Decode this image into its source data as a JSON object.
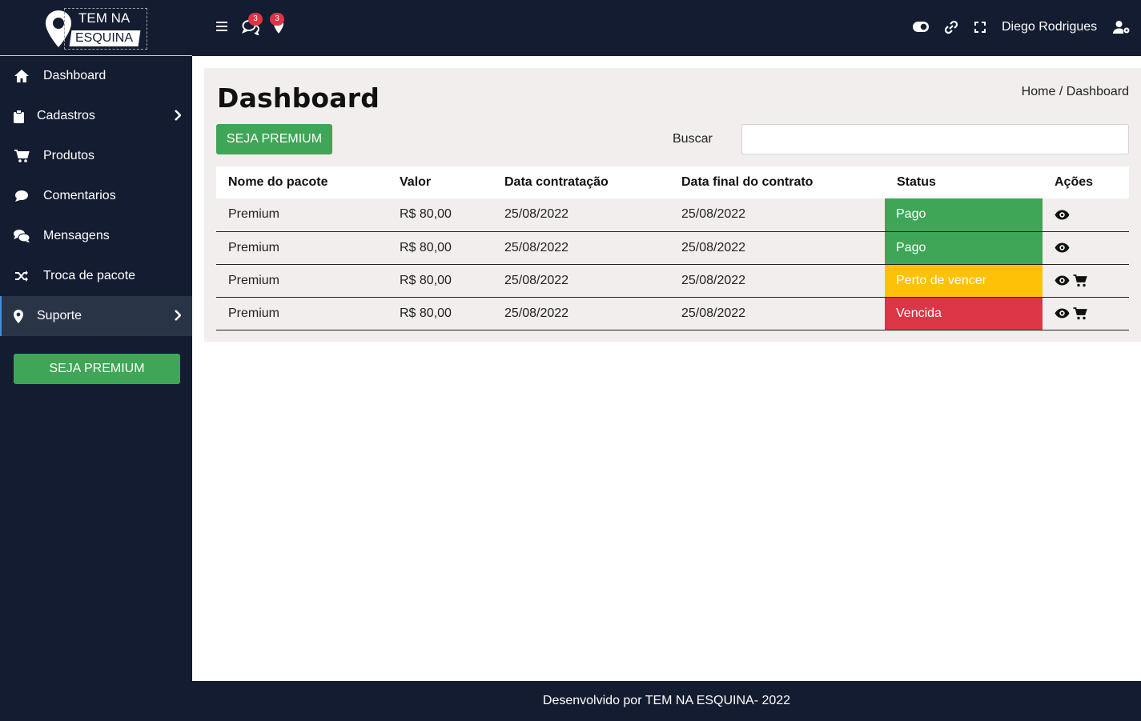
{
  "brand": {
    "line1": "TEM NA",
    "line2": "ESQUINA"
  },
  "sidebar": {
    "items": [
      {
        "label": "Dashboard",
        "icon": "home-icon"
      },
      {
        "label": "Cadastros",
        "icon": "clipboard-icon",
        "has_submenu": true
      },
      {
        "label": "Produtos",
        "icon": "cart-icon"
      },
      {
        "label": "Comentarios",
        "icon": "comment-icon"
      },
      {
        "label": "Mensagens",
        "icon": "comments-icon"
      },
      {
        "label": "Troca de pacote",
        "icon": "shuffle-icon"
      },
      {
        "label": "Suporte",
        "icon": "map-marker-icon",
        "has_submenu": true,
        "active": true
      }
    ],
    "premium_button": "SEJA PREMIUM"
  },
  "topbar": {
    "messages_badge": "3",
    "location_badge": "3",
    "user_name": "Diego Rodrigues",
    "icons": [
      "menu-icon",
      "comments-icon",
      "map-marker-icon",
      "toggle-icon",
      "link-icon",
      "fullscreen-icon",
      "user-cog-icon"
    ]
  },
  "main": {
    "title": "Dashboard",
    "breadcrumb": {
      "home": "Home",
      "separator": "/",
      "current": "Dashboard"
    },
    "premium_button": "SEJA PREMIUM",
    "search_label": "Buscar",
    "search_value": "",
    "table": {
      "headers": [
        "Nome do pacote",
        "Valor",
        "Data contratação",
        "Data final do contrato",
        "Status",
        "Ações"
      ],
      "rows": [
        {
          "name": "Premium",
          "value": "R$ 80,00",
          "start": "25/08/2022",
          "end": "25/08/2022",
          "status": "Pago",
          "status_color": "#3ea656",
          "actions": [
            "eye-icon"
          ]
        },
        {
          "name": "Premium",
          "value": "R$ 80,00",
          "start": "25/08/2022",
          "end": "25/08/2022",
          "status": "Pago",
          "status_color": "#3ea656",
          "actions": [
            "eye-icon"
          ]
        },
        {
          "name": "Premium",
          "value": "R$ 80,00",
          "start": "25/08/2022",
          "end": "25/08/2022",
          "status": "Perto de vencer",
          "status_color": "#ffc107",
          "actions": [
            "eye-icon",
            "cart-icon"
          ]
        },
        {
          "name": "Premium",
          "value": "R$ 80,00",
          "start": "25/08/2022",
          "end": "25/08/2022",
          "status": "Vencida",
          "status_color": "#dc3545",
          "actions": [
            "eye-icon",
            "cart-icon"
          ]
        }
      ]
    }
  },
  "footer": {
    "text": "Desenvolvido por TEM NA ESQUINA- 2022"
  },
  "colors": {
    "dark": "#141c32",
    "green": "#3ea656",
    "yellow": "#ffc107",
    "red": "#dc3545",
    "panel": "#f1eeed"
  }
}
